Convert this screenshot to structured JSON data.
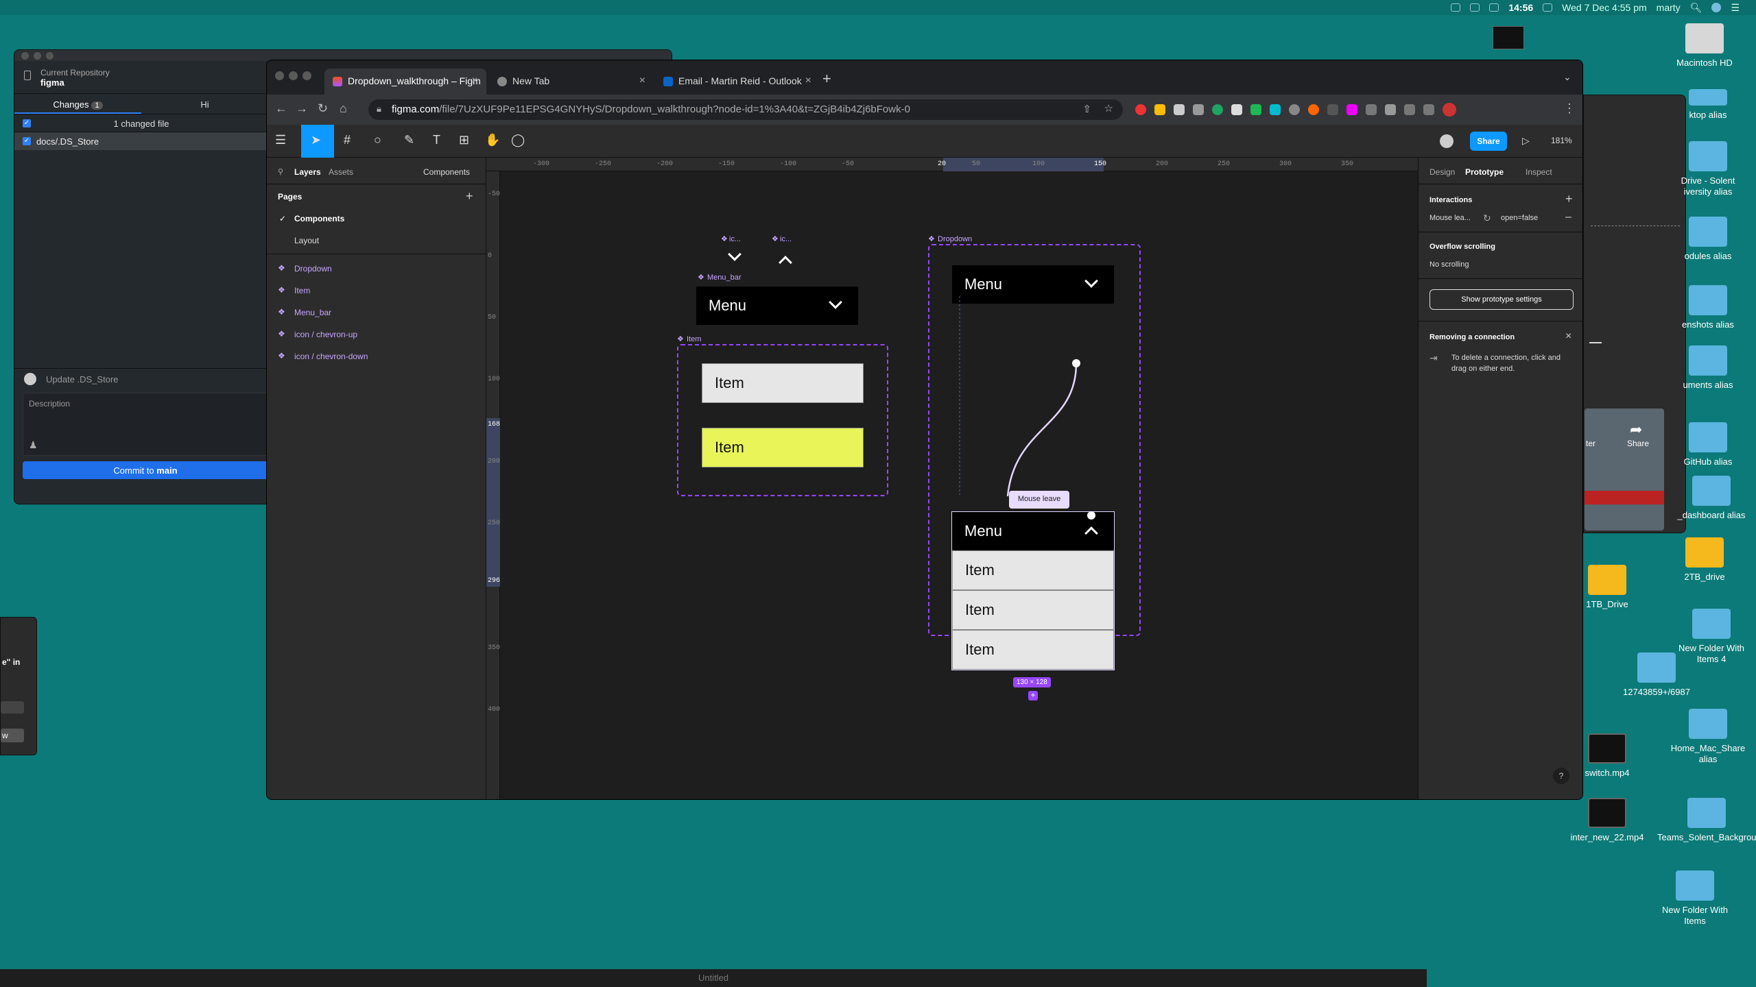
{
  "menubar": {
    "time": "14:56",
    "date": "Wed 7 Dec  4:55 pm",
    "user": "marty"
  },
  "github": {
    "repo_label": "Current Repository",
    "repo_name": "figma",
    "tab_changes": "Changes",
    "changes_count": "1",
    "tab_history": "Hi",
    "changed_files": "1 changed file",
    "file": "docs/.DS_Store",
    "summary_placeholder": "Update .DS_Store",
    "description_placeholder": "Description",
    "commit_prefix": "Commit to ",
    "commit_branch": "main"
  },
  "dialog": {
    "text": "e\" in",
    "button": "w"
  },
  "chrome": {
    "tabs": [
      {
        "title": "Dropdown_walkthrough – Figm",
        "active": true
      },
      {
        "title": "New Tab",
        "active": false
      },
      {
        "title": "Email - Martin Reid - Outlook",
        "active": false
      }
    ],
    "new_tab": "+",
    "url_domain": "figma.com",
    "url_path": "/file/7UzXUF9Pe11EPSG4GNYHyS/Dropdown_walkthrough?node-id=1%3A40&t=ZGjB4ib4Zj6bFowk-0"
  },
  "figma": {
    "share": "Share",
    "zoom": "181%",
    "left_tabs": {
      "layers": "Layers",
      "assets": "Assets",
      "components": "Components"
    },
    "pages_title": "Pages",
    "pages": [
      "Components",
      "Layout"
    ],
    "layers": [
      "Dropdown",
      "Item",
      "Menu_bar",
      "icon / chevron-up",
      "icon / chevron-down"
    ],
    "ruler_top": [
      "-300",
      "-250",
      "-200",
      "-150",
      "-100",
      "-50",
      "20",
      "50",
      "100",
      "150",
      "200",
      "250",
      "300",
      "350"
    ],
    "ruler_left": [
      "-50",
      "0",
      "50",
      "100",
      "168",
      "200",
      "250",
      "296",
      "350",
      "400"
    ],
    "canvas": {
      "icon_labels": [
        "ic...",
        "ic..."
      ],
      "menu_bar_label": "Menu_bar",
      "menu_text": "Menu",
      "item_frame_label": "Item",
      "item_text": "Item",
      "dropdown_label": "Dropdown",
      "connection_label": "Mouse leave",
      "size_badge": "130 × 128"
    },
    "right_tabs": [
      "Design",
      "Prototype",
      "Inspect"
    ],
    "interactions_title": "Interactions",
    "interaction_trigger": "Mouse lea...",
    "interaction_action": "open=false",
    "overflow_title": "Overflow scrolling",
    "overflow_value": "No scrolling",
    "proto_settings_button": "Show prototype settings",
    "removing_title": "Removing a connection",
    "removing_text": "To delete a connection, click and drag on either end.",
    "help": "?"
  },
  "desktop": {
    "icons": [
      "Macintosh HD",
      "ktop alias",
      "Drive - Solent iversity alias",
      "odules alias",
      "enshots alias",
      "uments alias",
      "GitHub alias",
      "_dashboard alias",
      "2TB_drive",
      "1TB_Drive",
      "New Folder With Items 4",
      "12743859+/6987",
      "Home_Mac_Share alias",
      "switch.mp4",
      "inter_new_22.mp4",
      "Teams_Solent_Backgrounds",
      "New Folder With Items"
    ],
    "preview_labels": [
      "ter",
      "Share"
    ]
  },
  "dock": {
    "title": "Untitled"
  }
}
